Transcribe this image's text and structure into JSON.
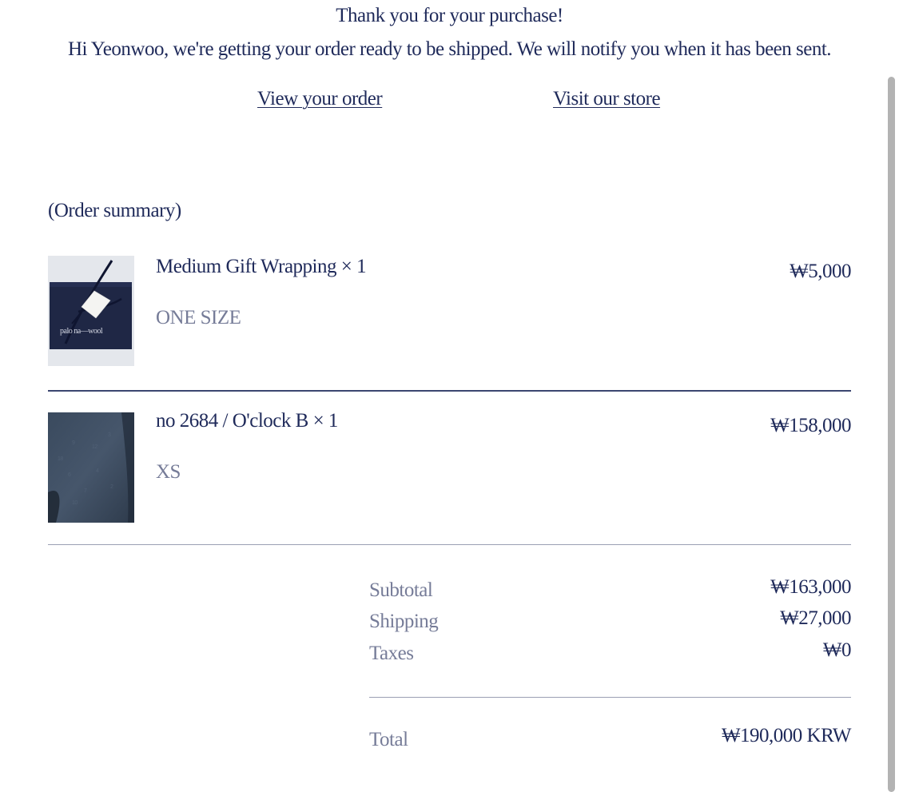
{
  "header": {
    "title": "Thank you for your purchase!",
    "message": "Hi Yeonwoo, we're getting your order ready to be shipped. We will notify you when it has been sent."
  },
  "links": {
    "view_order": "View your order",
    "visit_store": "Visit our store"
  },
  "summary": {
    "title": "(Order summary)",
    "items": [
      {
        "name": "Medium Gift Wrapping × 1",
        "variant": "ONE SIZE",
        "price": "₩5,000",
        "image_icon": "gift-wrapping-image",
        "image_text": "palo na—wool"
      },
      {
        "name": "no 2684 / O'clock B × 1",
        "variant": "XS",
        "price": "₩158,000",
        "image_icon": "knit-sweater-image"
      }
    ]
  },
  "totals": {
    "subtotal_label": "Subtotal",
    "subtotal_value": "₩163,000",
    "shipping_label": "Shipping",
    "shipping_value": "₩27,000",
    "taxes_label": "Taxes",
    "taxes_value": "₩0",
    "total_label": "Total",
    "total_value": "₩190,000 KRW"
  },
  "colors": {
    "text": "#1f2a5a",
    "muted": "#767c98",
    "divider": "#9a9fb3"
  }
}
